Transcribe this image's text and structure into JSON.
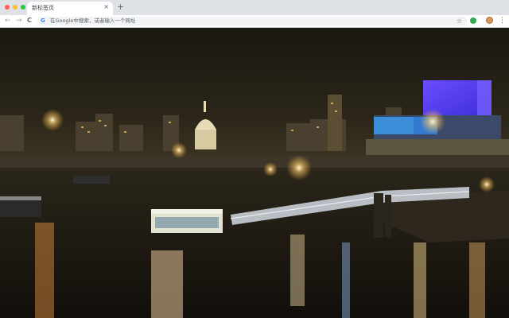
{
  "window": {
    "traffic_lights": [
      "#ff5f57",
      "#febc2e",
      "#28c840"
    ]
  },
  "tab": {
    "title": "新标签页",
    "close_glyph": "×",
    "new_tab_glyph": "+"
  },
  "toolbar": {
    "back_glyph": "←",
    "forward_glyph": "→",
    "reload_glyph": "C",
    "omnibox_placeholder": "在Google中搜索，或者输入一个网址",
    "google_glyph": "G",
    "bookmark_glyph": "☆",
    "menu_glyph": "⋮"
  },
  "icons": {
    "back": "arrow-left-icon",
    "forward": "arrow-right-icon",
    "reload": "reload-icon",
    "search": "google-g-icon",
    "bookmark": "star-icon",
    "extension": "extension-icon",
    "profile": "avatar-icon",
    "menu": "more-vert-icon"
  },
  "colors": {
    "chrome_bg": "#dee1e6",
    "omnibox_bg": "#f1f3f4",
    "accent_google": "#4285f4"
  },
  "background": {
    "description_kind": "photo",
    "subject": "night-city-river"
  }
}
